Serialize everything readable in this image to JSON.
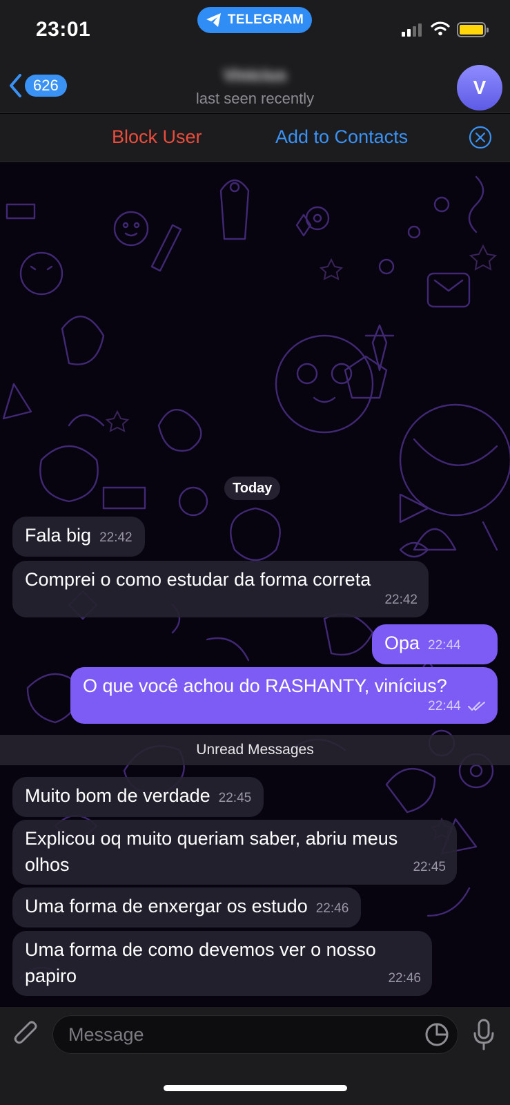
{
  "status_bar": {
    "time": "23:01",
    "app_name": "TELEGRAM",
    "battery_color": "#ffd60a"
  },
  "header": {
    "back_badge": "626",
    "contact_name": "Vinicius",
    "status": "last seen recently",
    "avatar_letter": "V"
  },
  "action_bar": {
    "block_label": "Block User",
    "add_label": "Add to Contacts"
  },
  "chat": {
    "date_label": "Today",
    "unread_label": "Unread Messages",
    "messages": [
      {
        "direction": "in",
        "text": "Fala big",
        "time": "22:42"
      },
      {
        "direction": "in",
        "text": "Comprei o como estudar da forma correta",
        "time": "22:42"
      },
      {
        "direction": "out",
        "text": "Opa",
        "time": "22:44",
        "read": true
      },
      {
        "direction": "out",
        "text": "O que você achou do RASHANTY, vinícius?",
        "time": "22:44",
        "read": true
      },
      {
        "direction": "in",
        "text": "Muito bom de verdade",
        "time": "22:45"
      },
      {
        "direction": "in",
        "text": "Explicou oq muito queriam saber, abriu meus olhos",
        "time": "22:45"
      },
      {
        "direction": "in",
        "text": "Uma forma de enxergar os estudo",
        "time": "22:46"
      },
      {
        "direction": "in",
        "text": "Uma forma de como devemos ver o nosso papiro",
        "time": "22:46"
      }
    ]
  },
  "input": {
    "placeholder": "Message"
  },
  "colors": {
    "accent": "#3a92f5",
    "danger": "#eb4d3d",
    "outgoing_bubble": "#7c5cf5",
    "incoming_bubble": "#26222f"
  },
  "icons": [
    "telegram-plane-icon",
    "signal-icon",
    "wifi-icon",
    "battery-icon",
    "back-chevron-icon",
    "close-circle-icon",
    "read-checks-icon",
    "attach-icon",
    "sticker-icon",
    "microphone-icon"
  ]
}
